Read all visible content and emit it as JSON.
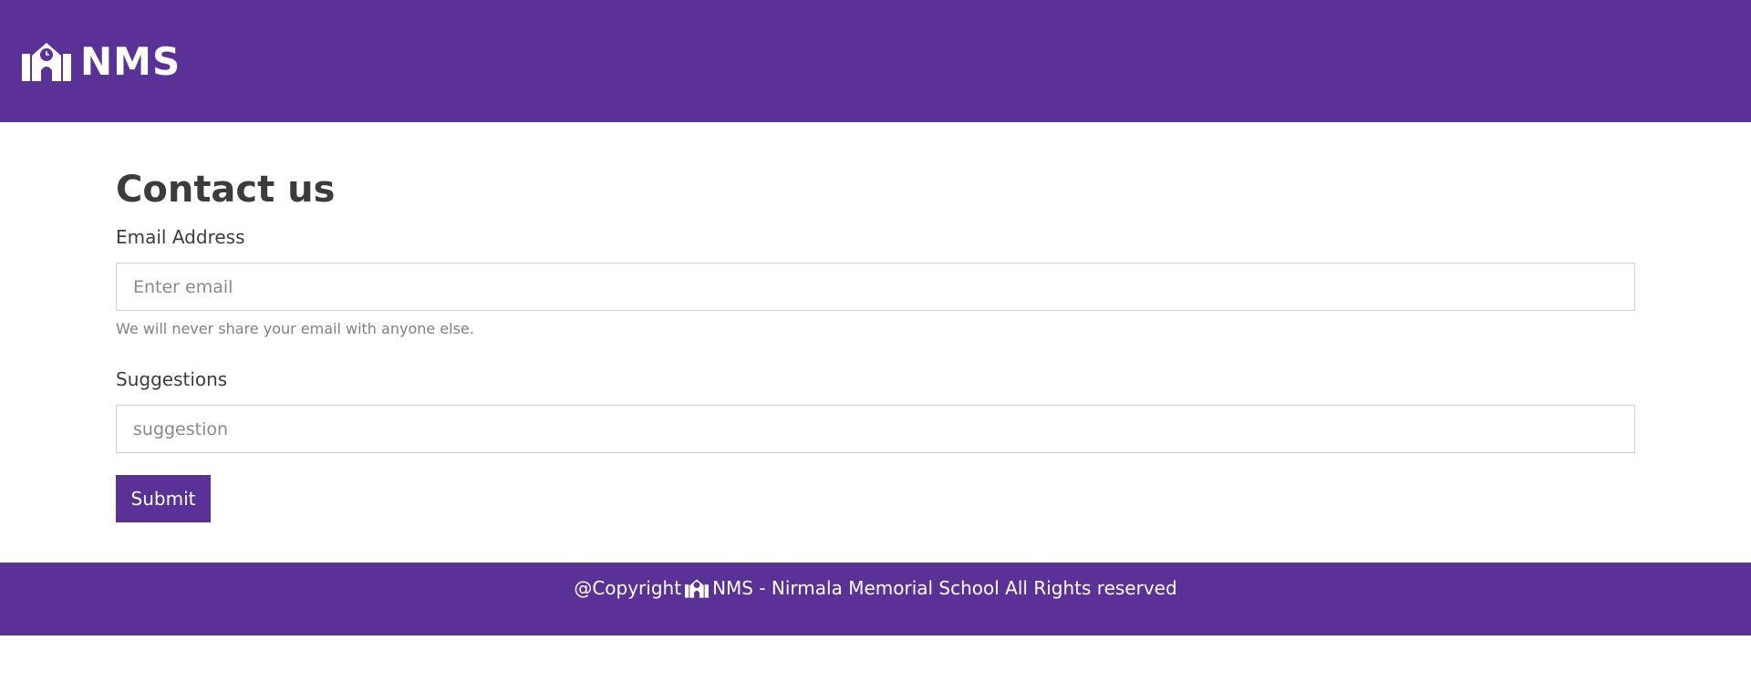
{
  "colors": {
    "brand": "#5a3197",
    "text": "#3c3c3c",
    "muted": "#808080"
  },
  "navbar": {
    "brand_icon": "school-icon",
    "brand_text": "NMS"
  },
  "contact_form": {
    "title": "Contact us",
    "email": {
      "label": "Email Address",
      "placeholder": "Enter email",
      "value": "",
      "help": "We will never share your email with anyone else."
    },
    "suggestions": {
      "label": "Suggestions",
      "placeholder": "suggestion",
      "value": ""
    },
    "submit_label": "Submit"
  },
  "footer": {
    "prefix": "@Copyright",
    "icon": "school-icon",
    "text": "NMS - Nirmala Memorial School All Rights reserved"
  }
}
